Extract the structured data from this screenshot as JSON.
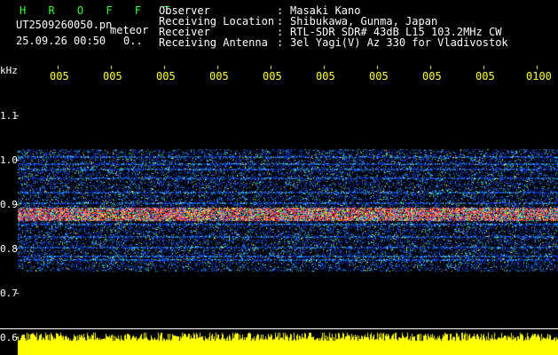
{
  "app": {
    "title": "H R O F F T",
    "filename": "UT2509260050.pn",
    "mode": "meteor",
    "datetime": "25.09.26 00:50",
    "count": "0.."
  },
  "info": {
    "rows": [
      {
        "label": "Observer",
        "value": "Masaki Kano"
      },
      {
        "label": "Receiving Location",
        "value": "Shibukawa, Gunma, Japan"
      },
      {
        "label": "Receiver",
        "value": "RTL-SDR SDR# 43dB L15 103.2MHz CW"
      },
      {
        "label": "Receiving Antenna",
        "value": "3el Yagi(V) Az 330 for Vladivostok"
      }
    ]
  },
  "axis": {
    "y_unit": "kHz",
    "y_ticks": [
      "1.1",
      "1.0",
      "0.9",
      "0.8",
      "0.7",
      "0.6"
    ],
    "x_ticks": [
      "005",
      "005",
      "005",
      "005",
      "005",
      "005",
      "005",
      "005",
      "005",
      "0100"
    ]
  },
  "colors": {
    "title": "#33ff33",
    "labels": "#ffffff",
    "ticks": "#ffff33",
    "amplitude": "#ffff00"
  }
}
